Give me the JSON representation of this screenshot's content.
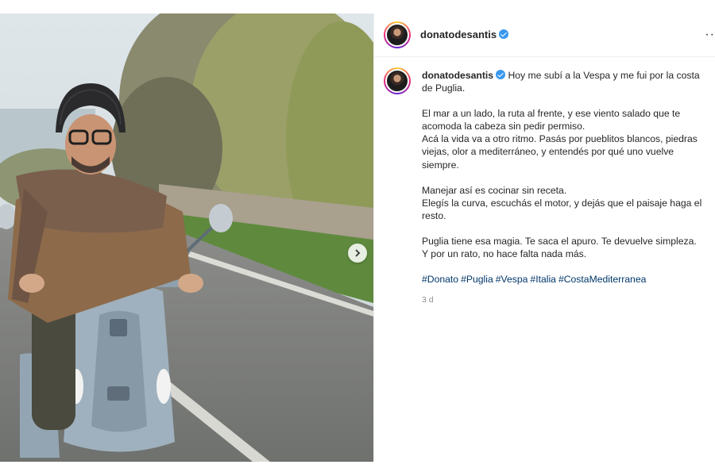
{
  "post": {
    "username": "donatodesantis",
    "verified": true,
    "more_icon": "more-horizontal-icon",
    "caption": {
      "username": "donatodesantis",
      "first_line": "Hoy me subí a la Vespa y me fui por la costa de Puglia.",
      "paragraphs": [
        "El mar a un lado, la ruta al frente, y ese viento salado que te acomoda la cabeza sin pedir permiso.\nAcá la vida va a otro ritmo. Pasás por pueblitos blancos, piedras viejas, olor a mediterráneo, y entendés por qué uno vuelve siempre.",
        "Manejar así es cocinar sin receta.\nElegís la curva, escuchás el motor, y dejás que el paisaje haga el resto.",
        "Puglia tiene esa magia. Te saca el apuro. Te devuelve simpleza.\nY por un rato, no hace falta nada más."
      ],
      "hashtags": [
        "#Donato",
        "#Puglia",
        "#Vespa",
        "#Italia",
        "#CostaMediterranea"
      ]
    },
    "timestamp": "3 d",
    "photo": {
      "description_icon": "photo-man-on-scooter",
      "next_icon": "chevron-right-icon"
    },
    "colors": {
      "verified_blue": "#3897f0",
      "hashtag_blue": "#00376b",
      "muted_gray": "#8e8e8e"
    }
  }
}
